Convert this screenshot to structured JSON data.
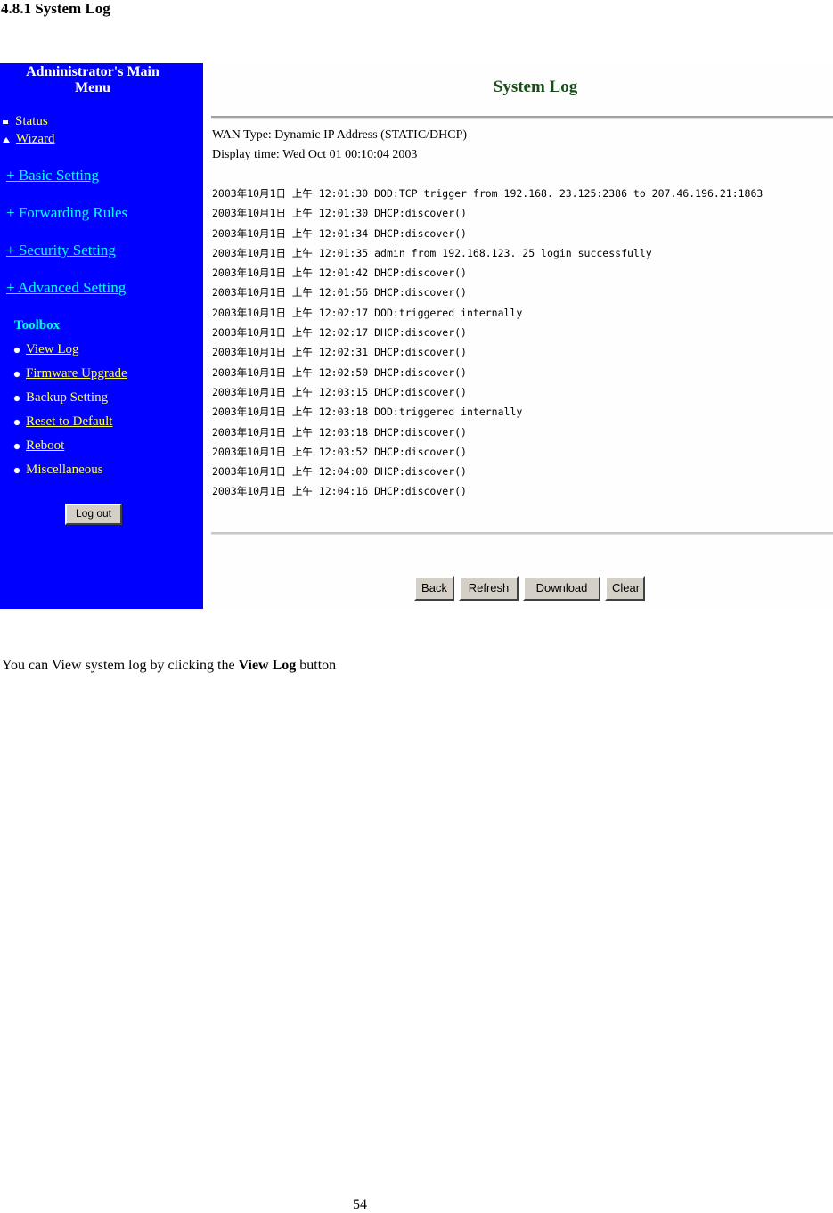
{
  "document": {
    "heading": "4.8.1 System Log",
    "caption_prefix": "You can View system log by clicking the ",
    "caption_bold": "View Log",
    "caption_suffix": " button",
    "page_number": "54"
  },
  "sidebar": {
    "title_line1": "Administrator's Main",
    "title_line2": "Menu",
    "top_items": [
      {
        "label": "Status",
        "bullet": "square"
      },
      {
        "label": "Wizard",
        "bullet": "triangle"
      }
    ],
    "sections": [
      {
        "label": "+ Basic Setting"
      },
      {
        "label": "+ Forwarding Rules"
      },
      {
        "label": "+ Security Setting"
      },
      {
        "label": "+ Advanced Setting"
      }
    ],
    "toolbox_label": "Toolbox",
    "toolbox_items": [
      {
        "label": "View Log"
      },
      {
        "label": "Firmware Upgrade"
      },
      {
        "label": "Backup Setting"
      },
      {
        "label": "Reset to Default"
      },
      {
        "label": "Reboot"
      },
      {
        "label": "Miscellaneous"
      }
    ],
    "logout_label": "Log out",
    "colors": {
      "background": "#0000fe",
      "section_link": "#00ffff",
      "item_link": "#ffff44"
    }
  },
  "main": {
    "title": "System Log",
    "title_color": "#1a4d1a",
    "wan_type": "WAN Type: Dynamic IP Address (STATIC/DHCP)",
    "display_time": "Display time: Wed Oct 01 00:10:04 2003",
    "log_lines": [
      "2003年10月1日 上午 12:01:30 DOD:TCP trigger from 192.168. 23.125:2386 to 207.46.196.21:1863",
      "2003年10月1日 上午 12:01:30 DHCP:discover()",
      "2003年10月1日 上午 12:01:34 DHCP:discover()",
      "2003年10月1日 上午 12:01:35 admin from 192.168.123. 25 login successfully",
      "2003年10月1日 上午 12:01:42 DHCP:discover()",
      "2003年10月1日 上午 12:01:56 DHCP:discover()",
      "2003年10月1日 上午 12:02:17 DOD:triggered internally",
      "2003年10月1日 上午 12:02:17 DHCP:discover()",
      "2003年10月1日 上午 12:02:31 DHCP:discover()",
      "2003年10月1日 上午 12:02:50 DHCP:discover()",
      "2003年10月1日 上午 12:03:15 DHCP:discover()",
      "2003年10月1日 上午 12:03:18 DOD:triggered internally",
      "2003年10月1日 上午 12:03:18 DHCP:discover()",
      "2003年10月1日 上午 12:03:52 DHCP:discover()",
      "2003年10月1日 上午 12:04:00 DHCP:discover()",
      "2003年10月1日 上午 12:04:16 DHCP:discover()"
    ],
    "buttons": {
      "back": "Back",
      "refresh": "Refresh",
      "download": "Download",
      "clear": "Clear"
    }
  }
}
